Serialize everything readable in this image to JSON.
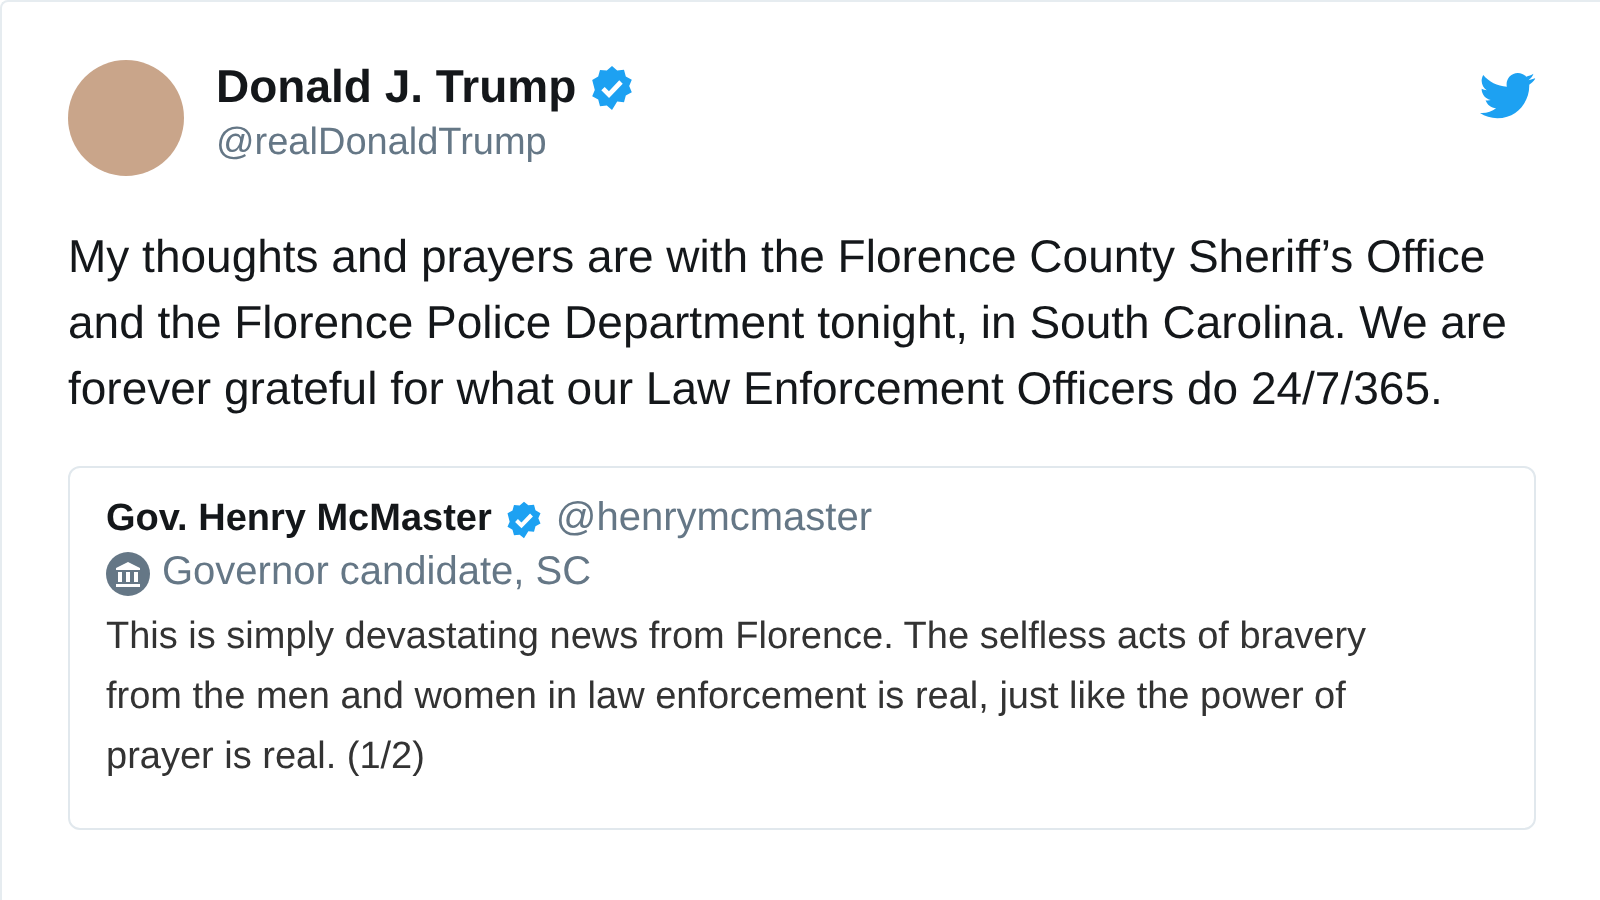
{
  "tweet": {
    "author": {
      "name": "Donald J. Trump",
      "verified": true,
      "handle": "@realDonaldTrump"
    },
    "text": "My thoughts and prayers are with the Florence County Sheriff’s Office and the Florence Police Department tonight, in South Carolina. We are forever grateful for what our Law Enforcement Officers do 24/7/365.",
    "quoted_tweet": {
      "author": {
        "name": "Gov. Henry McMaster",
        "verified": true,
        "handle": "@henrymcmaster"
      },
      "label": "Governor candidate, SC",
      "text": "This is simply devastating news from Florence. The selfless acts of bravery from the men and women in law enforcement is real, just like the power of prayer is real. (1/2)"
    }
  }
}
